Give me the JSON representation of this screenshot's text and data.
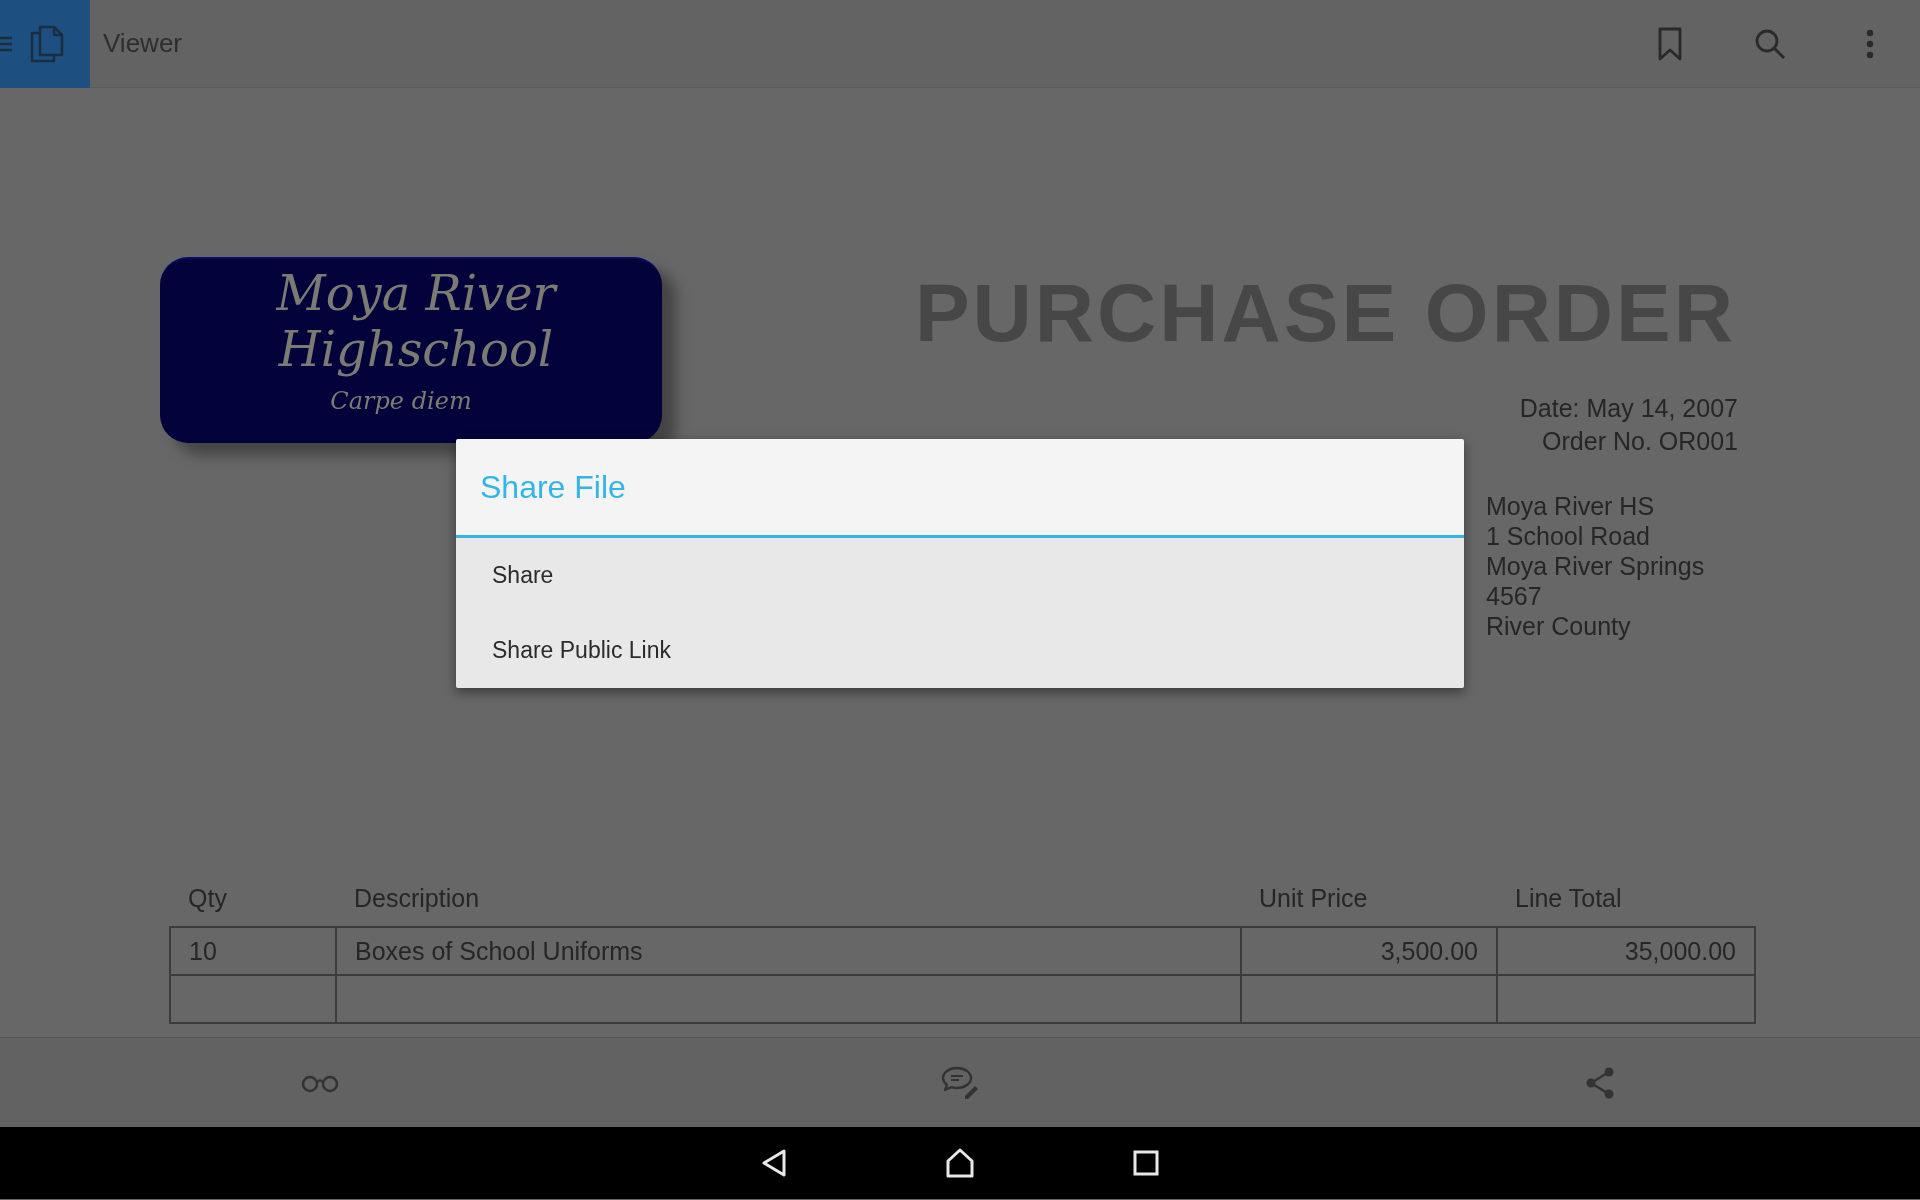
{
  "top_bar": {
    "title": "Viewer"
  },
  "document": {
    "logo": {
      "name_lines": [
        "Moya River",
        "Highschool"
      ],
      "motto": "Carpe diem"
    },
    "title": "PURCHASE ORDER",
    "date": "Date: May 14, 2007",
    "order_no": "Order No. OR001",
    "address": [
      "Moya River HS",
      "1 School Road",
      "Moya River Springs",
      "4567",
      "River County"
    ],
    "table": {
      "columns": [
        "Qty",
        "Description",
        "Unit Price",
        "Line Total"
      ],
      "rows": [
        {
          "kind": "data",
          "cells": [
            "10",
            "Boxes of School Uniforms",
            "3,500.00",
            "35,000.00"
          ]
        },
        {
          "kind": "blank"
        }
      ]
    }
  },
  "dialog": {
    "title": "Share File",
    "items": [
      "Share",
      "Share Public Link"
    ]
  }
}
